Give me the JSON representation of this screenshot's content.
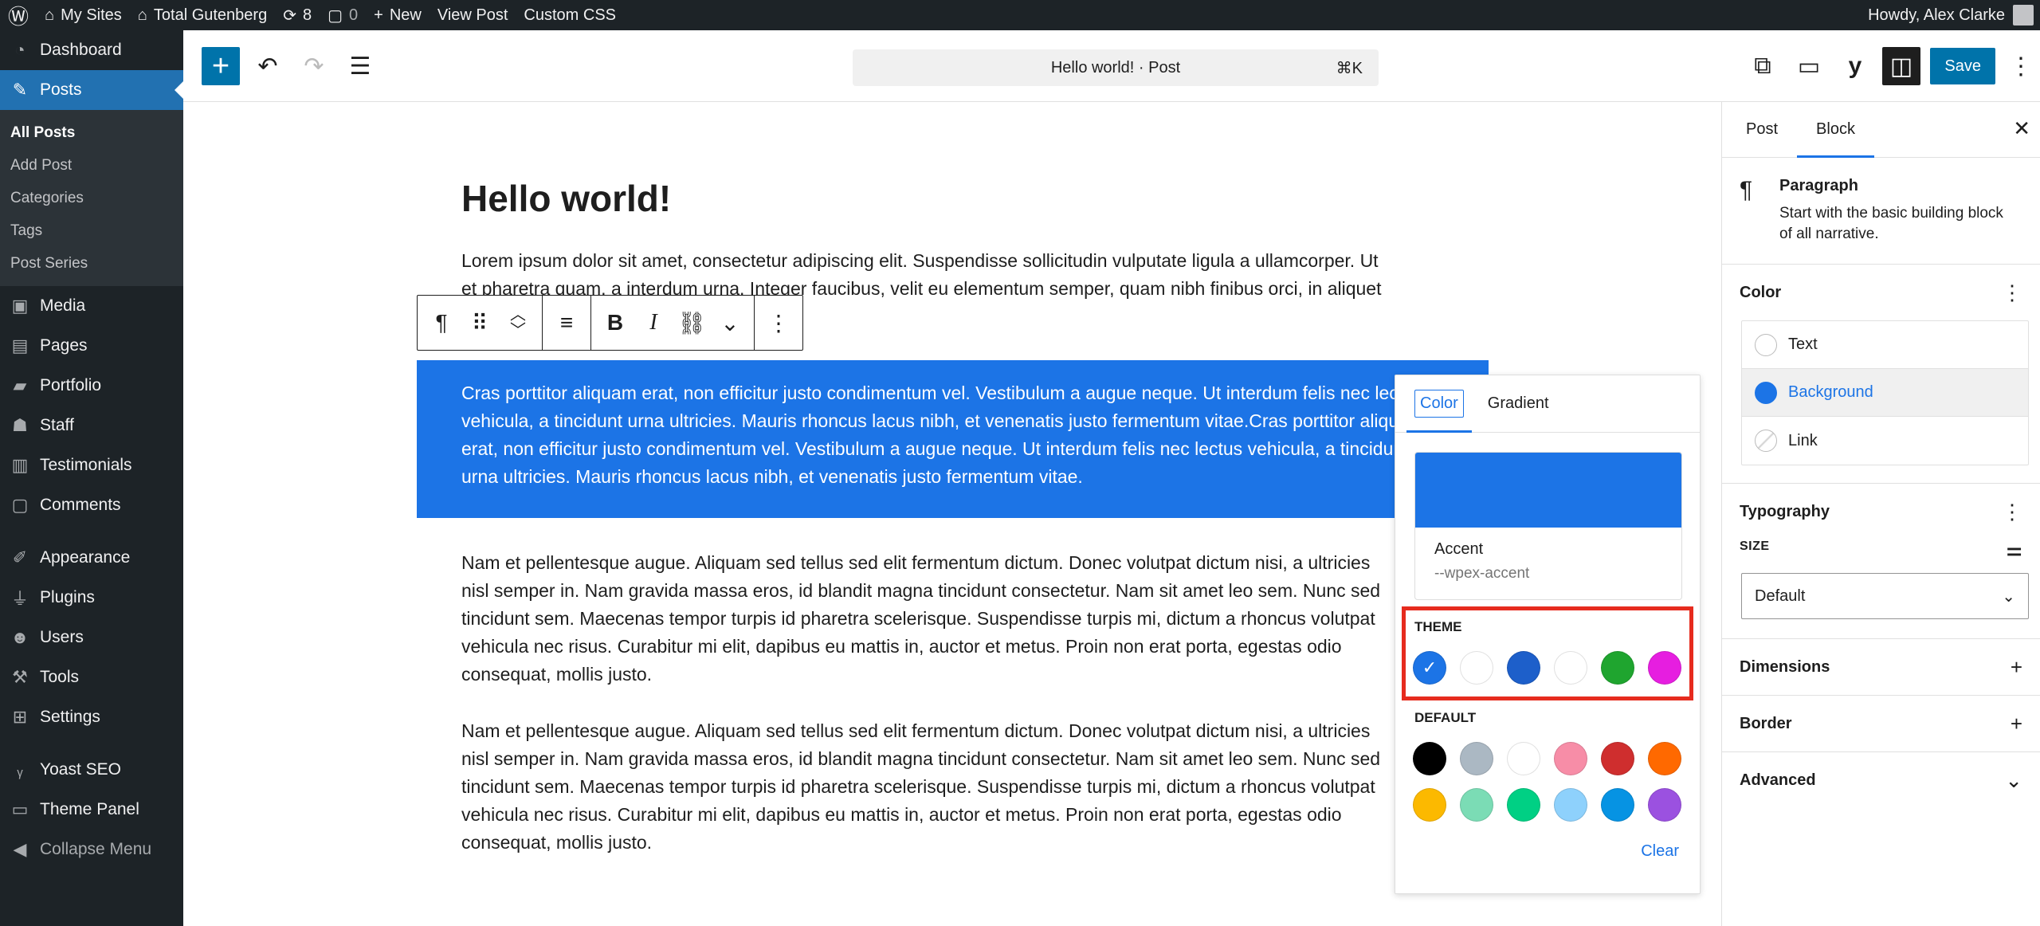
{
  "adminbar": {
    "my_sites": "My Sites",
    "site_name": "Total Gutenberg",
    "updates_count": "8",
    "comments_count": "0",
    "new": "New",
    "view_post": "View Post",
    "custom_css": "Custom CSS",
    "howdy": "Howdy, Alex Clarke"
  },
  "sidebar": {
    "dashboard": "Dashboard",
    "posts": "Posts",
    "submenu": [
      "All Posts",
      "Add Post",
      "Categories",
      "Tags",
      "Post Series"
    ],
    "media": "Media",
    "pages": "Pages",
    "portfolio": "Portfolio",
    "staff": "Staff",
    "testimonials": "Testimonials",
    "comments": "Comments",
    "appearance": "Appearance",
    "plugins": "Plugins",
    "users": "Users",
    "tools": "Tools",
    "settings": "Settings",
    "yoast": "Yoast SEO",
    "theme_panel": "Theme Panel",
    "collapse": "Collapse Menu"
  },
  "topbar": {
    "doc_title": "Hello world! · Post",
    "shortcut": "⌘K",
    "save": "Save"
  },
  "post": {
    "title": "Hello world!",
    "paragraph1": "Lorem ipsum dolor sit amet, consectetur adipiscing elit. Suspendisse sollicitudin vulputate ligula a ullamcorper. Ut et pharetra quam, a interdum urna. Integer faucibus, velit eu elementum semper, quam nibh finibus orci, in aliquet",
    "paragraph2": "Cras porttitor aliquam erat, non efficitur justo condimentum vel. Vestibulum a augue neque. Ut interdum felis nec lectus vehicula, a tincidunt urna ultricies. Mauris rhoncus lacus nibh, et venenatis justo fermentum vitae.Cras porttitor aliquam erat, non efficitur justo condimentum vel. Vestibulum a augue neque. Ut interdum felis nec lectus vehicula, a tincidunt urna ultricies. Mauris rhoncus lacus nibh, et venenatis justo fermentum vitae.",
    "paragraph3": "Nam et pellentesque augue. Aliquam sed tellus sed elit fermentum dictum. Donec volutpat dictum nisi, a ultricies nisl semper in. Nam gravida massa eros, id blandit magna tincidunt consectetur. Nam sit amet leo sem. Nunc sed tincidunt sem. Maecenas tempor turpis id pharetra scelerisque. Suspendisse turpis mi, dictum a rhoncus volutpat vehicula nec risus. Curabitur mi elit, dapibus eu mattis in, auctor et metus. Proin non erat porta, egestas odio consequat, mollis justo.",
    "paragraph4": "Nam et pellentesque augue. Aliquam sed tellus sed elit fermentum dictum. Donec volutpat dictum nisi, a ultricies nisl semper in. Nam gravida massa eros, id blandit magna tincidunt consectetur. Nam sit amet leo sem. Nunc sed tincidunt sem. Maecenas tempor turpis id pharetra scelerisque. Suspendisse turpis mi, dictum a rhoncus volutpat vehicula nec risus. Curabitur mi elit, dapibus eu mattis in, auctor et metus. Proin non erat porta, egestas odio consequat, mollis justo."
  },
  "popover": {
    "tab_color": "Color",
    "tab_gradient": "Gradient",
    "selected_name": "Accent",
    "selected_var": "--wpex-accent",
    "theme_label": "THEME",
    "default_label": "DEFAULT",
    "clear": "Clear",
    "theme_colors": [
      "#1c74e6",
      "#ffffff",
      "#1d5fca",
      "#ffffff",
      "#1fa52f",
      "#e61ee0"
    ],
    "default_colors": [
      "#000000",
      "#abb8c3",
      "#ffffff",
      "#f78da7",
      "#cf2e2e",
      "#ff6900",
      "#fcb900",
      "#7bdcb5",
      "#00d084",
      "#8ed1fc",
      "#0693e3",
      "#9b51e0"
    ]
  },
  "settings": {
    "tab_post": "Post",
    "tab_block": "Block",
    "block_name": "Paragraph",
    "block_desc": "Start with the basic building block of all narrative.",
    "color_title": "Color",
    "color_text": "Text",
    "color_background": "Background",
    "color_link": "Link",
    "typography_title": "Typography",
    "size_label": "SIZE",
    "size_value": "Default",
    "dimensions": "Dimensions",
    "border": "Border",
    "advanced": "Advanced"
  },
  "colors": {
    "accent": "#1c74e6",
    "wp_blue": "#0073aa",
    "admin_dark": "#1d2327",
    "highlight_red": "#e62b1e"
  }
}
